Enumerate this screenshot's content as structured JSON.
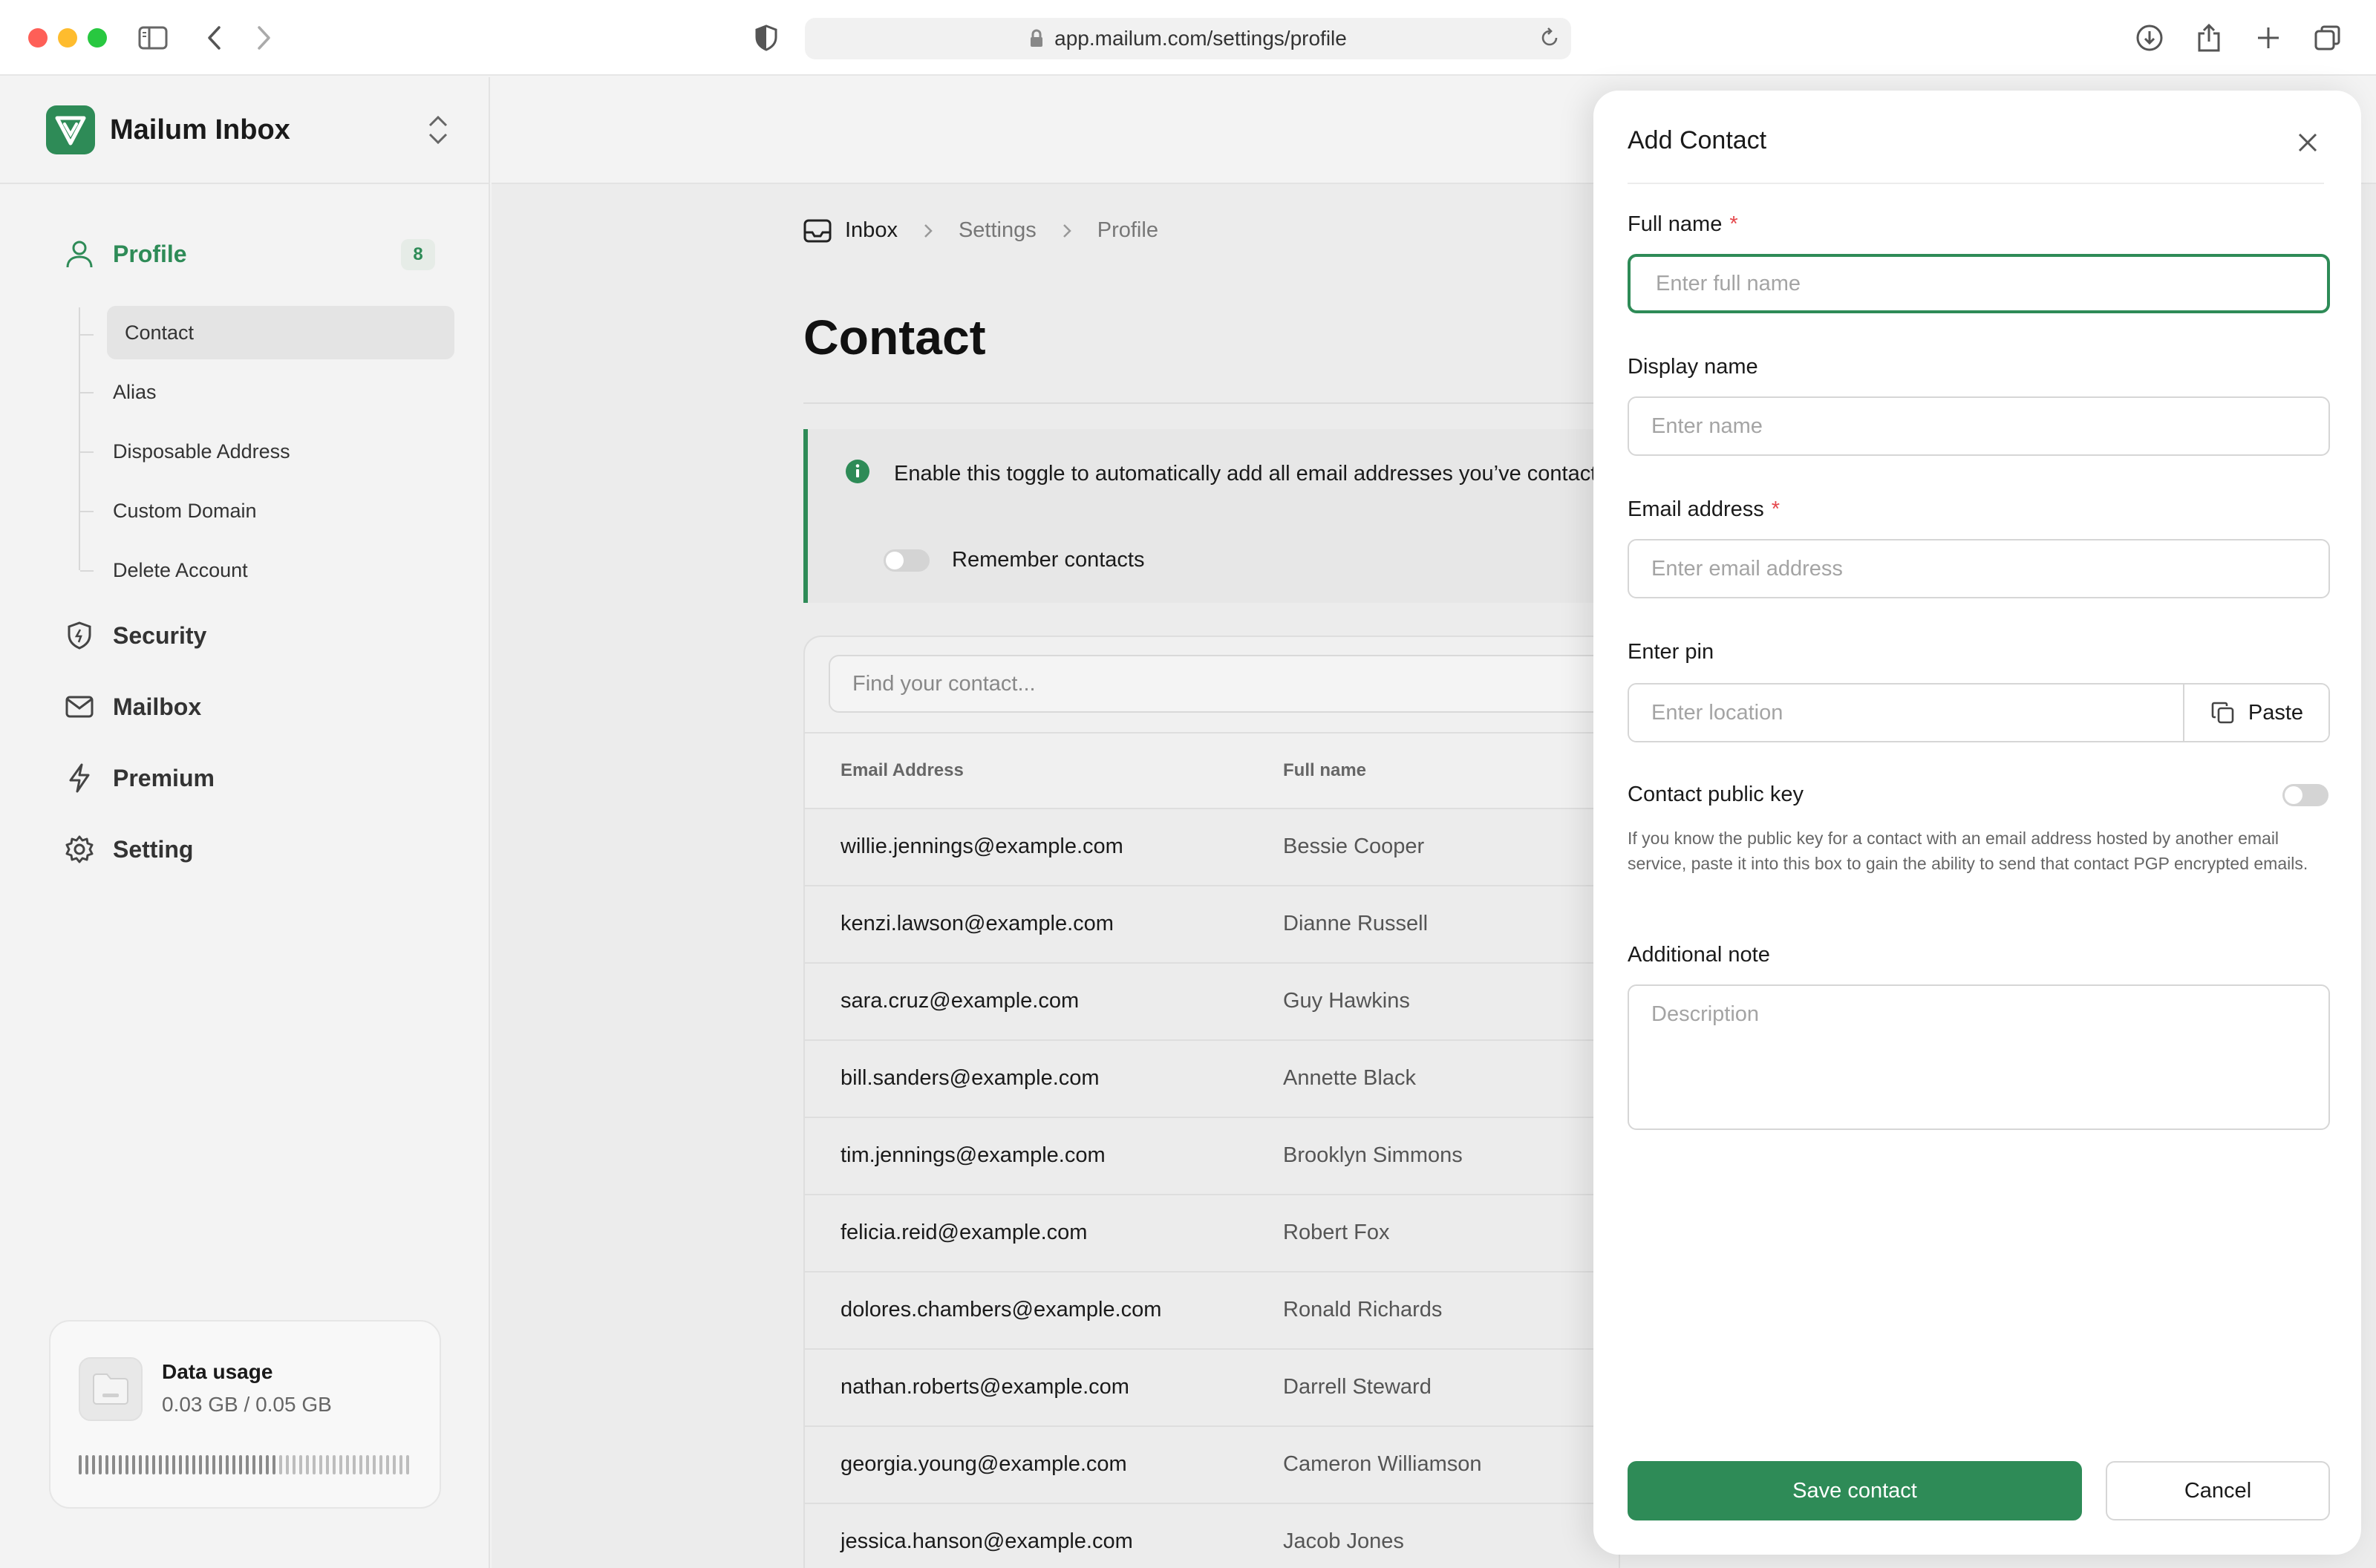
{
  "browser": {
    "url": "app.mailum.com/settings/profile",
    "icons": [
      "sidebar-icon",
      "back-icon",
      "forward-icon",
      "shield-icon",
      "lock-icon",
      "reload-icon",
      "download-icon",
      "share-icon",
      "plus-icon",
      "tabs-icon"
    ]
  },
  "brand": {
    "name": "Mailum Inbox",
    "accent": "#2e8b57"
  },
  "sidebar": {
    "profile": {
      "label": "Profile",
      "badge": "8"
    },
    "sub_items": [
      "Contact",
      "Alias",
      "Disposable Address",
      "Custom Domain",
      "Delete Account"
    ],
    "items": [
      {
        "label": "Security",
        "icon": "shield-icon"
      },
      {
        "label": "Mailbox",
        "icon": "mail-icon"
      },
      {
        "label": "Premium",
        "icon": "bolt-icon"
      },
      {
        "label": "Setting",
        "icon": "gear-icon"
      }
    ],
    "usage": {
      "title": "Data usage",
      "value": "0.03 GB / 0.05 GB",
      "fraction": 0.6
    }
  },
  "main": {
    "breadcrumb": [
      "Inbox",
      "Settings",
      "Profile"
    ],
    "title": "Contact",
    "notice": {
      "text": "Enable this toggle to automatically add all email addresses you’ve contacted to your contact list for easy access.",
      "toggle_label": "Remember contacts"
    },
    "search_placeholder": "Find your contact...",
    "columns": [
      "Email Address",
      "Full name"
    ],
    "rows": [
      {
        "email": "willie.jennings@example.com",
        "name": "Bessie Cooper"
      },
      {
        "email": "kenzi.lawson@example.com",
        "name": "Dianne Russell"
      },
      {
        "email": "sara.cruz@example.com",
        "name": "Guy Hawkins"
      },
      {
        "email": "bill.sanders@example.com",
        "name": "Annette Black"
      },
      {
        "email": "tim.jennings@example.com",
        "name": "Brooklyn Simmons"
      },
      {
        "email": "felicia.reid@example.com",
        "name": "Robert Fox"
      },
      {
        "email": "dolores.chambers@example.com",
        "name": "Ronald Richards"
      },
      {
        "email": "nathan.roberts@example.com",
        "name": "Darrell Steward"
      },
      {
        "email": "georgia.young@example.com",
        "name": "Cameron Williamson"
      },
      {
        "email": "jessica.hanson@example.com",
        "name": "Jacob Jones"
      }
    ]
  },
  "dialog": {
    "title": "Add Contact",
    "full_name": {
      "label": "Full name",
      "required": "*",
      "placeholder": "Enter full name"
    },
    "display_name": {
      "label": "Display name",
      "placeholder": "Enter name"
    },
    "email": {
      "label": "Email address",
      "required": "*",
      "placeholder": "Enter email address"
    },
    "pin": {
      "label": "Enter pin",
      "placeholder": "Enter location",
      "paste_label": "Paste"
    },
    "public_key": {
      "label": "Contact public key",
      "help": "If you know the public key for a contact with an email address hosted by another email service, paste it into this box to gain the ability to send that contact PGP encrypted emails."
    },
    "note": {
      "label": "Additional note",
      "placeholder": "Description"
    },
    "save_label": "Save contact",
    "cancel_label": "Cancel"
  }
}
